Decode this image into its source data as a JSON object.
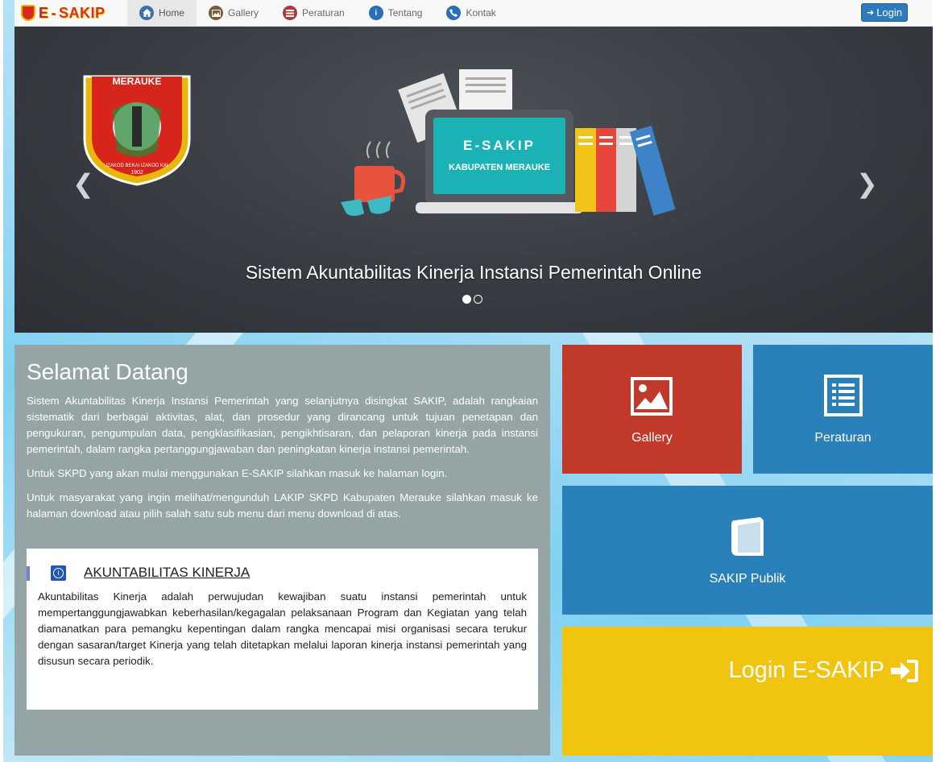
{
  "brand": {
    "prefix": "E",
    "dash": "-",
    "name": "SAKIP"
  },
  "nav": {
    "items": [
      {
        "label": "Home",
        "icon": "home-icon",
        "color": "#3d6fa8"
      },
      {
        "label": "Gallery",
        "icon": "image-icon",
        "color": "#7a5c3a"
      },
      {
        "label": "Peraturan",
        "icon": "list-icon",
        "color": "#b33a3a"
      },
      {
        "label": "Tentang",
        "icon": "info-icon",
        "color": "#2a6eb5"
      },
      {
        "label": "Kontak",
        "icon": "phone-icon",
        "color": "#2a6eb5"
      }
    ],
    "login_label": "Login"
  },
  "carousel": {
    "logo_text": "MERAUKE",
    "logo_motto": "IZAKOD BEKAI IZAKOD KAI",
    "logo_year": "1902",
    "screen_title": "E-SAKIP",
    "screen_subtitle": "KABUPATEN MERAUKE",
    "caption": "Sistem Akuntabilitas Kinerja Instansi Pemerintah Online",
    "slides": 2,
    "active_slide": 1
  },
  "welcome": {
    "title": "Selamat Datang",
    "p1": "Sistem Akuntabilitas Kinerja Instansi Pemerintah yang selanjutnya disingkat SAKIP, adalah rangkaian sistematik dari berbagai aktivitas, alat, dan prosedur yang dirancang untuk tujuan penetapan dan pengukuran, pengumpulan data, pengklasifikasian, pengikhtisaran, dan pelaporan kinerja pada instansi pemerintah, dalam rangka pertanggungjawaban dan peningkatan kinerja instansi pemerintah.",
    "p2": "Untuk SKPD yang akan mulai menggunakan E-SAKIP silahkan masuk ke halaman login.",
    "p3": "Untuk masyarakat yang ingin melihat/mengunduh LAKIP SKPD Kabupaten Merauke silahkan masuk ke halaman download atau pilih salah satu sub menu dari menu download di atas.",
    "info": {
      "title": "AKUNTABILITAS KINERJA",
      "text": "Akuntabilitas Kinerja adalah perwujudan kewajiban suatu instansi pemerintah untuk mempertanggungjawabkan keberhasilan/kegagalan pelaksanaan Program dan Kegiatan yang telah diamanatkan para pemangku kepentingan dalam rangka mencapai misi organisasi secara terukur dengan sasaran/target Kinerja yang telah ditetapkan melalui laporan kinerja instansi pemerintah yang disusun secara periodik."
    }
  },
  "tiles": {
    "gallery": "Gallery",
    "peraturan": "Peraturan",
    "publik": "SAKIP Publik",
    "login": "Login E-SAKIP"
  },
  "colors": {
    "gallery": "#c0392b",
    "blue": "#2a80b9",
    "login": "#f1c40f",
    "panel": "#95a5a6"
  }
}
